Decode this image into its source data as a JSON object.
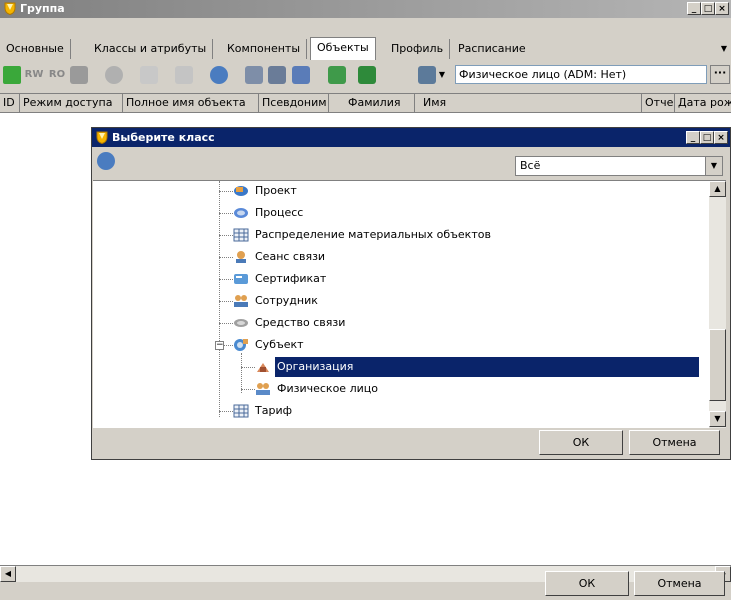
{
  "window": {
    "title": "Группа",
    "min": "_",
    "max": "□",
    "close": "×"
  },
  "tabs": [
    {
      "label": "Основные"
    },
    {
      "label": "Классы и атрибуты"
    },
    {
      "label": "Компоненты"
    },
    {
      "label": "Объекты"
    },
    {
      "label": "Профиль"
    },
    {
      "label": "Расписание"
    }
  ],
  "active_tab": "Объекты",
  "toolbar": {
    "rw": "RW",
    "ro": "RO",
    "filter_value": "Физическое лицо (ADM: Нет)",
    "more": "···"
  },
  "grid": {
    "columns": [
      "ID",
      "Режим доступа",
      "Полное имя объекта",
      "Псевдоним",
      "Фамилия",
      "Имя",
      "Отчество",
      "Дата рождения"
    ]
  },
  "dialog": {
    "title": "Выберите класс",
    "filter": "Всё",
    "tree": [
      {
        "label": "Проект",
        "icon": "project-icon"
      },
      {
        "label": "Процесс",
        "icon": "process-icon"
      },
      {
        "label": "Распределение материальных объектов",
        "icon": "table-icon"
      },
      {
        "label": "Сеанс связи",
        "icon": "session-icon"
      },
      {
        "label": "Сертификат",
        "icon": "certificate-icon"
      },
      {
        "label": "Сотрудник",
        "icon": "employee-icon"
      },
      {
        "label": "Средство связи",
        "icon": "communication-icon"
      },
      {
        "label": "Субъект",
        "icon": "subject-icon",
        "expander": "−"
      },
      {
        "label": "Организация",
        "icon": "organization-icon",
        "selected": true
      },
      {
        "label": "Физическое лицо",
        "icon": "person-icon"
      },
      {
        "label": "Тариф",
        "icon": "table-icon"
      }
    ],
    "ok": "ОК",
    "cancel": "Отмена"
  },
  "footer": {
    "ok": "ОК",
    "cancel": "Отмена"
  },
  "colors": {
    "dialog_title": "#0a246a",
    "selection": "#0a246a",
    "window_title_start": "#808080"
  }
}
